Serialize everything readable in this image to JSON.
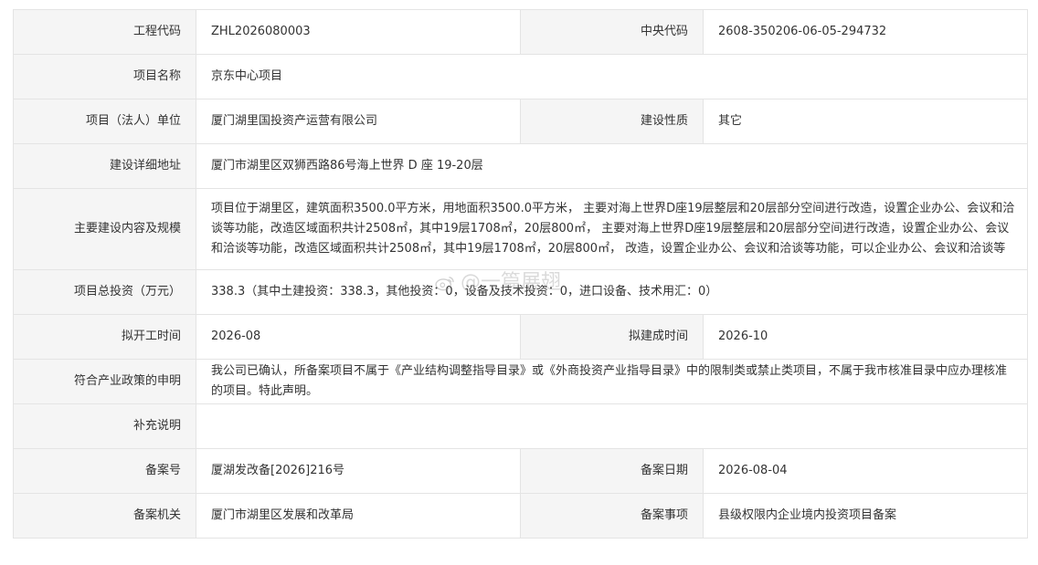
{
  "rows": {
    "project_code": {
      "label": "工程代码",
      "value": "ZHL2026080003"
    },
    "central_code": {
      "label": "中央代码",
      "value": "2608-350206-06-05-294732"
    },
    "project_name": {
      "label": "项目名称",
      "value": "京东中心项目"
    },
    "legal_unit": {
      "label": "项目（法人）单位",
      "value": "厦门湖里国投资产运营有限公司"
    },
    "build_nature": {
      "label": "建设性质",
      "value": "其它"
    },
    "address": {
      "label": "建设详细地址",
      "value": "厦门市湖里区双狮西路86号海上世界 D 座 19-20层"
    },
    "content": {
      "label": "主要建设内容及规模",
      "value": "项目位于湖里区，建筑面积3500.0平方米，用地面积3500.0平方米， 主要对海上世界D座19层整层和20层部分空间进行改造，设置企业办公、会议和洽谈等功能，改造区域面积共计2508㎡，其中19层1708㎡，20层800㎡， 主要对海上世界D座19层整层和20层部分空间进行改造，设置企业办公、会议和洽谈等功能，改造区域面积共计2508㎡，其中19层1708㎡，20层800㎡， 改造，设置企业办公、会议和洽谈等功能，可以企业办公、会议和洽谈等"
    },
    "investment": {
      "label": "项目总投资（万元）",
      "value": "338.3（其中土建投资：338.3，其他投资：0，设备及技术投资：0，进口设备、技术用汇：0）"
    },
    "start_time": {
      "label": "拟开工时间",
      "value": "2026-08"
    },
    "finish_time": {
      "label": "拟建成时间",
      "value": "2026-10"
    },
    "policy": {
      "label": "符合产业政策的申明",
      "value": "我公司已确认，所备案项目不属于《产业结构调整指导目录》或《外商投资产业指导目录》中的限制类或禁止类项目，不属于我市核准目录中应办理核准的项目。特此声明。"
    },
    "supplement": {
      "label": "补充说明",
      "value": ""
    },
    "record_no": {
      "label": "备案号",
      "value": "厦湖发改备[2026]216号"
    },
    "record_date": {
      "label": "备案日期",
      "value": "2026-08-04"
    },
    "record_org": {
      "label": "备案机关",
      "value": "厦门市湖里区发展和改革局"
    },
    "record_item": {
      "label": "备案事项",
      "value": "县级权限内企业境内投资项目备案"
    }
  },
  "watermark": {
    "text": "@一篇展翅",
    "icon": "weibo-icon"
  }
}
